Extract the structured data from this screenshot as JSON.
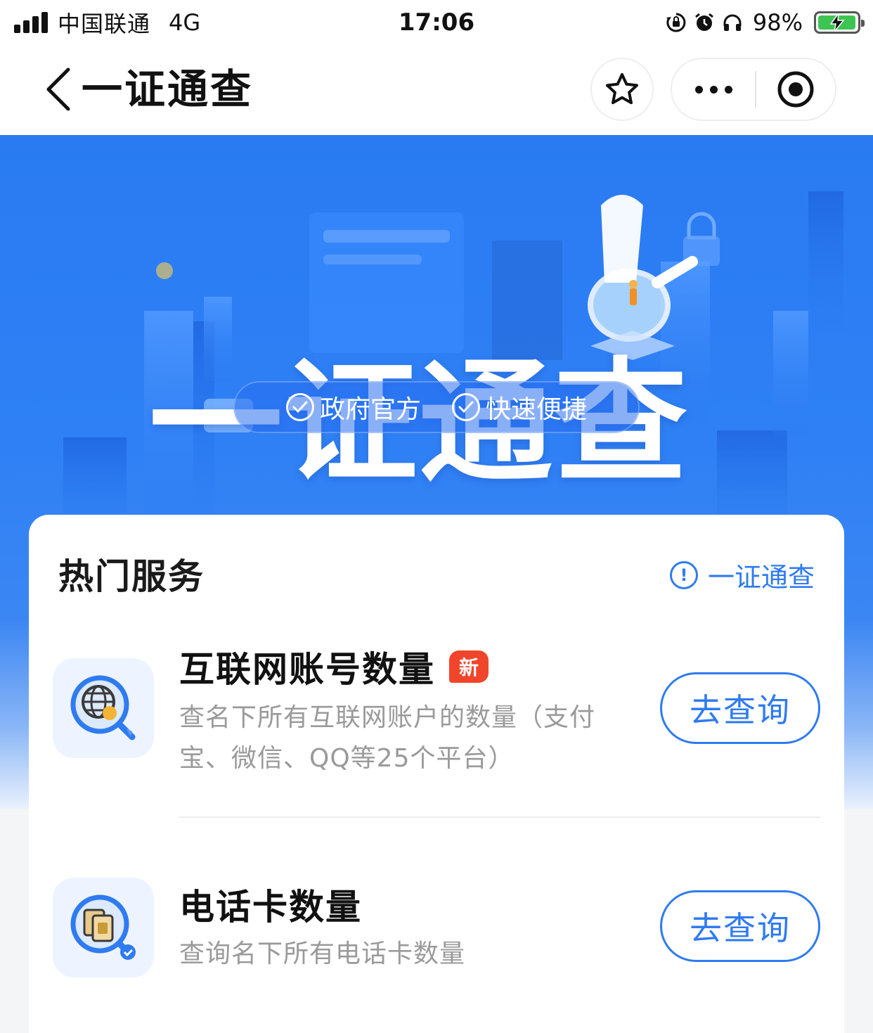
{
  "status_bar": {
    "carrier": "中国联通",
    "network": "4G",
    "time": "17:06",
    "battery_percent_text": "98%",
    "battery_level": 0.98,
    "icons": [
      "signal-icon",
      "rotation-lock-icon",
      "alarm-icon",
      "headphones-icon",
      "battery-charging-icon"
    ]
  },
  "nav": {
    "title": "一证通查",
    "icons": [
      "back-icon",
      "star-icon",
      "more-icon",
      "close-target-icon"
    ]
  },
  "banner": {
    "title": "一证通查",
    "badges": [
      "政府官方",
      "快速便捷"
    ]
  },
  "hot_services": {
    "title": "热门服务",
    "link_label": "一证通查",
    "items": [
      {
        "name": "互联网账号数量",
        "tag": "新",
        "desc_line1": "查名下所有互联网账户的数量（支付",
        "desc_line2": "宝、微信、QQ等25个平台）",
        "button": "去查询",
        "icon": "globe-search-icon"
      },
      {
        "name": "电话卡数量",
        "desc_line1": "查询名下所有电话卡数量",
        "button": "去查询",
        "icon": "sim-card-search-icon"
      }
    ]
  },
  "colors": {
    "accent": "#2f7bf0",
    "banner_blue": "#2a7bf2",
    "new_tag": "#f0452b",
    "battery_green": "#3ec453"
  }
}
